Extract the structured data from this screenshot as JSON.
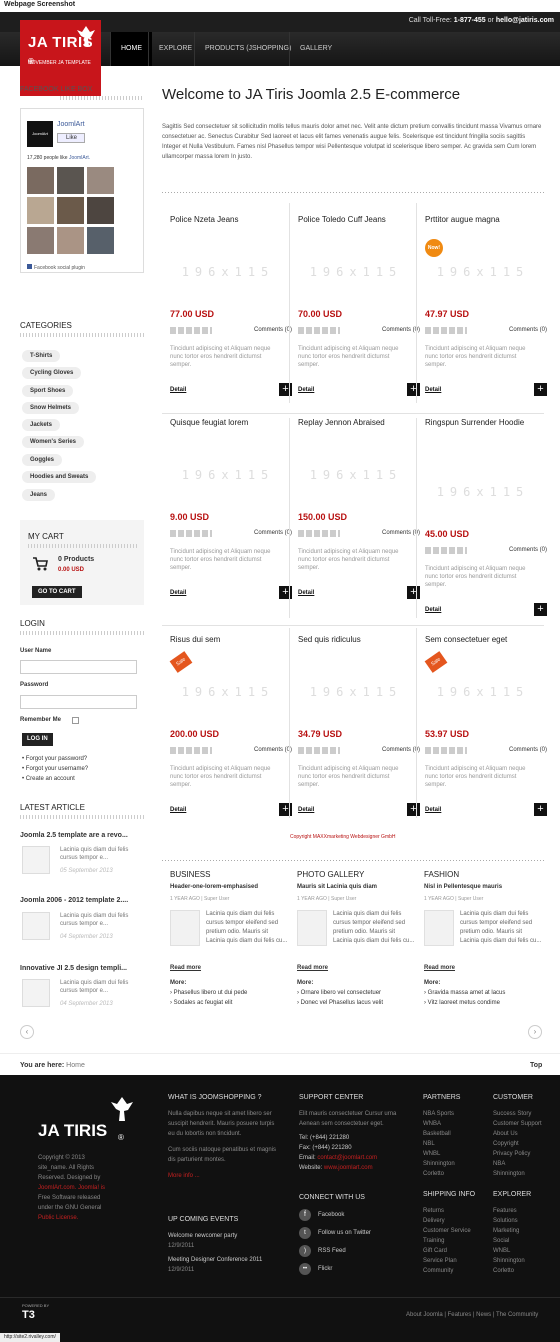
{
  "shot_label": "Webpage Screenshot",
  "topbar": {
    "tollfree_label": "Call Toll-Free:",
    "tollfree": "1-877-455",
    "or": "or",
    "email": "hello@jatiris.com"
  },
  "logo": {
    "title": "JA TIRIS",
    "registered": "®",
    "subtitle": "NOVEMBER JA TEMPLATE"
  },
  "nav": [
    "HOME",
    "EXPLORE",
    "PRODUCTS (JSHOPPING)",
    "GALLERY"
  ],
  "facebook": {
    "heading": "FACEBOOK LIKE BOX",
    "page_name": "JoomlArt",
    "like": "Like",
    "people": "17,280 people like",
    "people_link": "JoomlArt.",
    "plugin": "Facebook social plugin"
  },
  "categories": {
    "heading": "CATEGORIES",
    "items": [
      "T-Shirts",
      "Cycling Gloves",
      "Sport Shoes",
      "Snow Helmets",
      "Jackets",
      "Women's Series",
      "Goggles",
      "Hoodies and Sweats",
      "Jeans"
    ]
  },
  "cart": {
    "heading": "MY CART",
    "products": "0 Products",
    "amount": "0.00 USD",
    "button": "GO TO CART"
  },
  "login": {
    "heading": "LOGIN",
    "user_label": "User Name",
    "pass_label": "Password",
    "remember": "Remember Me",
    "button": "LOG IN",
    "links": [
      "Forgot your password?",
      "Forgot your username?",
      "Create an account"
    ]
  },
  "latest": {
    "heading": "LATEST ARTICLE",
    "items": [
      {
        "title": "Joomla 2.5 template are a revo...",
        "text": "Lacinia quis diam dui felis cursus tempor e...",
        "date": "05 September 2013"
      },
      {
        "title": "Joomla 2006 - 2012 template 2....",
        "text": "Lacinia quis diam dui felis cursus tempor e...",
        "date": "04 September 2013"
      },
      {
        "title": "Innovative JI 2.5 design templi...",
        "text": "Lacinia quis diam dui felis cursus tempor e...",
        "date": "04 September 2013"
      }
    ]
  },
  "welcome": {
    "title": "Welcome to JA Tiris Joomla 2.5 E-commerce",
    "text": "Sagittis Sed consectetuer sit sollicitudin mollis tellus mauris dolor amet nec. Velit ante dictum pretium convallis tincidunt massa Vivamus ornare consectetuer ac. Senectus Curabitur Sed laoreet et lacus elit fames venenatis augue felis. Scelerisque est tincidunt fringilla sociis sagittis Integer et Nulla Vestibulum. Fames nisl Phasellus tempor wisi Pellentesque volutpat id scelerisque libero semper. Ac gravida sem Cum lorem ullamcorper massa lorem In justo."
  },
  "product_common": {
    "img_text": "196x115",
    "comments": "Comments (0)",
    "desc": "Tincidunt adipiscing et Aliquam neque nunc tortor eros hendrerit dictumst semper.",
    "detail": "Detail",
    "plus": "+"
  },
  "products": [
    {
      "name": "Police Nzeta Jeans",
      "price": "77.00 USD",
      "tag": ""
    },
    {
      "name": "Police Toledo Cuff Jeans",
      "price": "70.00 USD",
      "tag": ""
    },
    {
      "name": "Prttitor augue magna",
      "price": "47.97 USD",
      "tag": "Now!"
    },
    {
      "name": "Quisque feugiat lorem",
      "price": "9.00 USD",
      "tag": ""
    },
    {
      "name": "Replay Jennon Abraised",
      "price": "150.00 USD",
      "tag": ""
    },
    {
      "name": "Ringspun Surrender Hoodie",
      "price": "45.00 USD",
      "tag": ""
    },
    {
      "name": "Risus dui sem",
      "price": "200.00 USD",
      "tag": "Sale"
    },
    {
      "name": "Sed quis ridiculus",
      "price": "34.79 USD",
      "tag": ""
    },
    {
      "name": "Sem consectetuer eget",
      "price": "53.97 USD",
      "tag": "Sale"
    }
  ],
  "copyright_line": "Copyright MAXXmarketing Webdesigner GmbH",
  "bottom_articles": [
    {
      "section": "BUSINESS",
      "title": "Header-one-lorem-emphasised",
      "meta": "1 YEAR AGO | Super User",
      "text": "Lacinia quis diam dui felis cursus tempor eleifend sed pretium odio. Mauris sit Lacinia quis diam dui felis cu...",
      "more": "Read more",
      "more_label": "More:",
      "links": [
        "Phasellus libero ut dui pede",
        "Sodales ac feugiat elit"
      ]
    },
    {
      "section": "PHOTO GALLERY",
      "title": "Mauris sit Lacinia quis diam",
      "meta": "1 YEAR AGO | Super User",
      "text": "Lacinia quis diam dui felis cursus tempor eleifend sed pretium odio. Mauris sit Lacinia quis diam dui felis cu...",
      "more": "Read more",
      "more_label": "More:",
      "links": [
        "Ornare libero vel consectetuer",
        "Donec vel Phasellus lacus velit"
      ]
    },
    {
      "section": "FASHION",
      "title": "Nisl in Pellentesque mauris",
      "meta": "1 YEAR AGO | Super User",
      "text": "Lacinia quis diam dui felis cursus tempor eleifend sed pretium odio. Mauris sit Lacinia quis diam dui felis cu...",
      "more": "Read more",
      "more_label": "More:",
      "links": [
        "Gravida massa amet at lacus",
        "Vitz laoreet metus condime"
      ]
    }
  ],
  "breadcrumb": {
    "label": "You are here:",
    "home": "Home",
    "top": "Top"
  },
  "footer": {
    "logo": "JA TIRIS",
    "copyright": [
      "Copyright © 2013",
      "site_name. All Rights",
      "Reserved. Designed by",
      "JoomlArt.com. Joomla! is",
      "Free Software released",
      "under the GNU General",
      "Public License."
    ],
    "what": {
      "heading": "WHAT IS JOOMSHOPPING ?",
      "text1": "Nulla dapibus neque sit amet libero ser suscipit hendrerit. Mauris posuere turpis eu du lobortis non tincidunt.",
      "text2": "Cum sociis natoque penatibus et magnis dis parturient montes.",
      "more": "More info ..."
    },
    "events": {
      "heading": "UP COMING EVENTS",
      "items": [
        {
          "title": "Welcome newcomer party",
          "date": "12/9/2011"
        },
        {
          "title": "Meeting Designer Conference 2011",
          "date": "12/9/2011"
        }
      ]
    },
    "support": {
      "heading": "SUPPORT CENTER",
      "text": "Elit mauris consectetuer Cursur urna Aenean sem consectetuer eget.",
      "tel": "Tel: (+844) 221280",
      "fax": "Fax: (+844) 221280",
      "email_label": "Email:",
      "email": "contact@joomlart.com",
      "web_label": "Website:",
      "web": "www.joomlart.com"
    },
    "connect": {
      "heading": "CONNECT WITH US",
      "items": [
        "Facebook",
        "Follow us on Twitter",
        "RSS Feed",
        "Flickr"
      ]
    },
    "partners": {
      "heading": "PARTNERS",
      "items": [
        "NBA Sports",
        "WNBA",
        "Basketball",
        "NBL",
        "WNBL",
        "Shinnington",
        "Corletto"
      ]
    },
    "customer": {
      "heading": "CUSTOMER",
      "items": [
        "Success Story",
        "Customer Support",
        "About Us",
        "Copyright",
        "Privacy Policy",
        "NBA",
        "Shinnington"
      ]
    },
    "shipping": {
      "heading": "SHIPPING INFO",
      "items": [
        "Returns",
        "Delivery",
        "Customer Service",
        "Training",
        "Gift Card",
        "Service Plan",
        "Community"
      ]
    },
    "explorer": {
      "heading": "EXPLORER",
      "items": [
        "Features",
        "Solutions",
        "Marketing",
        "Social",
        "WNBL",
        "Shinnington",
        "Corletto"
      ]
    },
    "powered": "POWERED BY",
    "t3": "T3",
    "links": "About Joomla | Features | News | The Community",
    "status": "http://site2.rivalley.com/"
  }
}
